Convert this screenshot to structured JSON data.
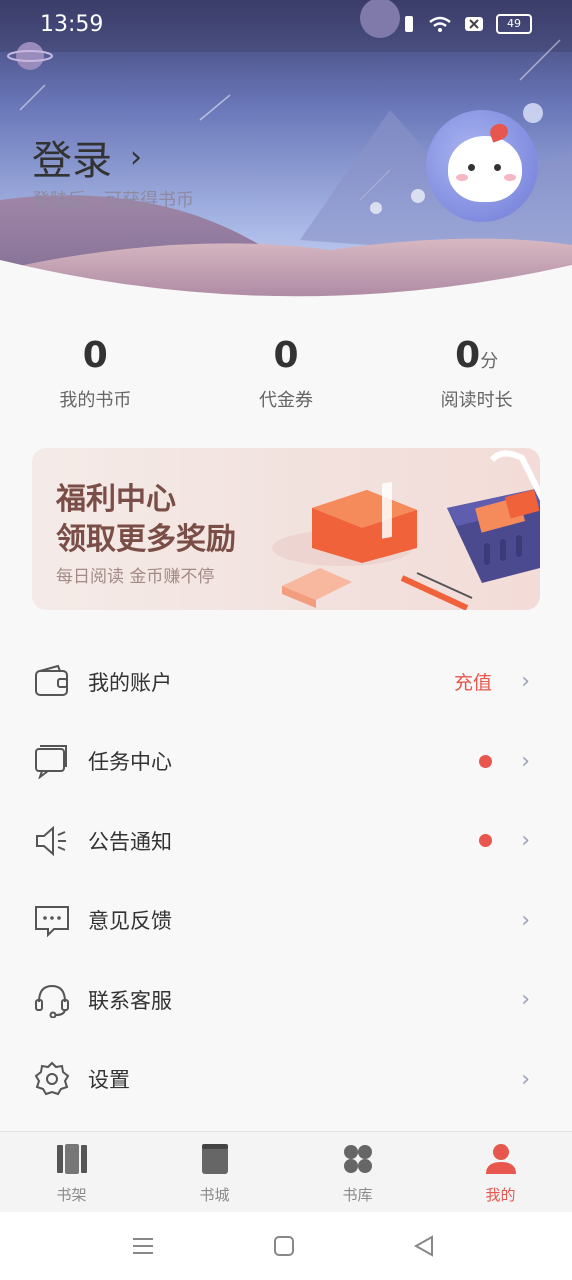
{
  "status_bar": {
    "time": "13:59",
    "battery": "49"
  },
  "profile": {
    "login_label": "登录",
    "login_chevron": "›",
    "login_hint": "登陆后，可获得书币"
  },
  "stats": [
    {
      "value": "0",
      "unit": "",
      "label": "我的书币"
    },
    {
      "value": "0",
      "unit": "",
      "label": "代金券"
    },
    {
      "value": "0",
      "unit": "分",
      "label": "阅读时长"
    }
  ],
  "banner": {
    "title_line1": "福利中心",
    "title_line2": "领取更多奖励",
    "subtitle": "每日阅读 金币赚不停"
  },
  "menu": [
    {
      "label": "我的账户",
      "extra": "充值",
      "dot": false,
      "icon": "wallet-icon"
    },
    {
      "label": "任务中心",
      "extra": "",
      "dot": true,
      "icon": "task-icon"
    },
    {
      "label": "公告通知",
      "extra": "",
      "dot": true,
      "icon": "speaker-icon"
    },
    {
      "label": "意见反馈",
      "extra": "",
      "dot": false,
      "icon": "feedback-icon"
    },
    {
      "label": "联系客服",
      "extra": "",
      "dot": false,
      "icon": "headset-icon"
    },
    {
      "label": "设置",
      "extra": "",
      "dot": false,
      "icon": "gear-icon"
    }
  ],
  "arrow_glyph": "›",
  "tabs": [
    {
      "label": "书架",
      "icon": "bookshelf-icon",
      "active": false
    },
    {
      "label": "书城",
      "icon": "book-icon",
      "active": false
    },
    {
      "label": "书库",
      "icon": "library-icon",
      "active": false
    },
    {
      "label": "我的",
      "icon": "profile-icon",
      "active": true
    }
  ],
  "colors": {
    "accent": "#e8574d",
    "text": "#333333",
    "muted": "#666666"
  }
}
